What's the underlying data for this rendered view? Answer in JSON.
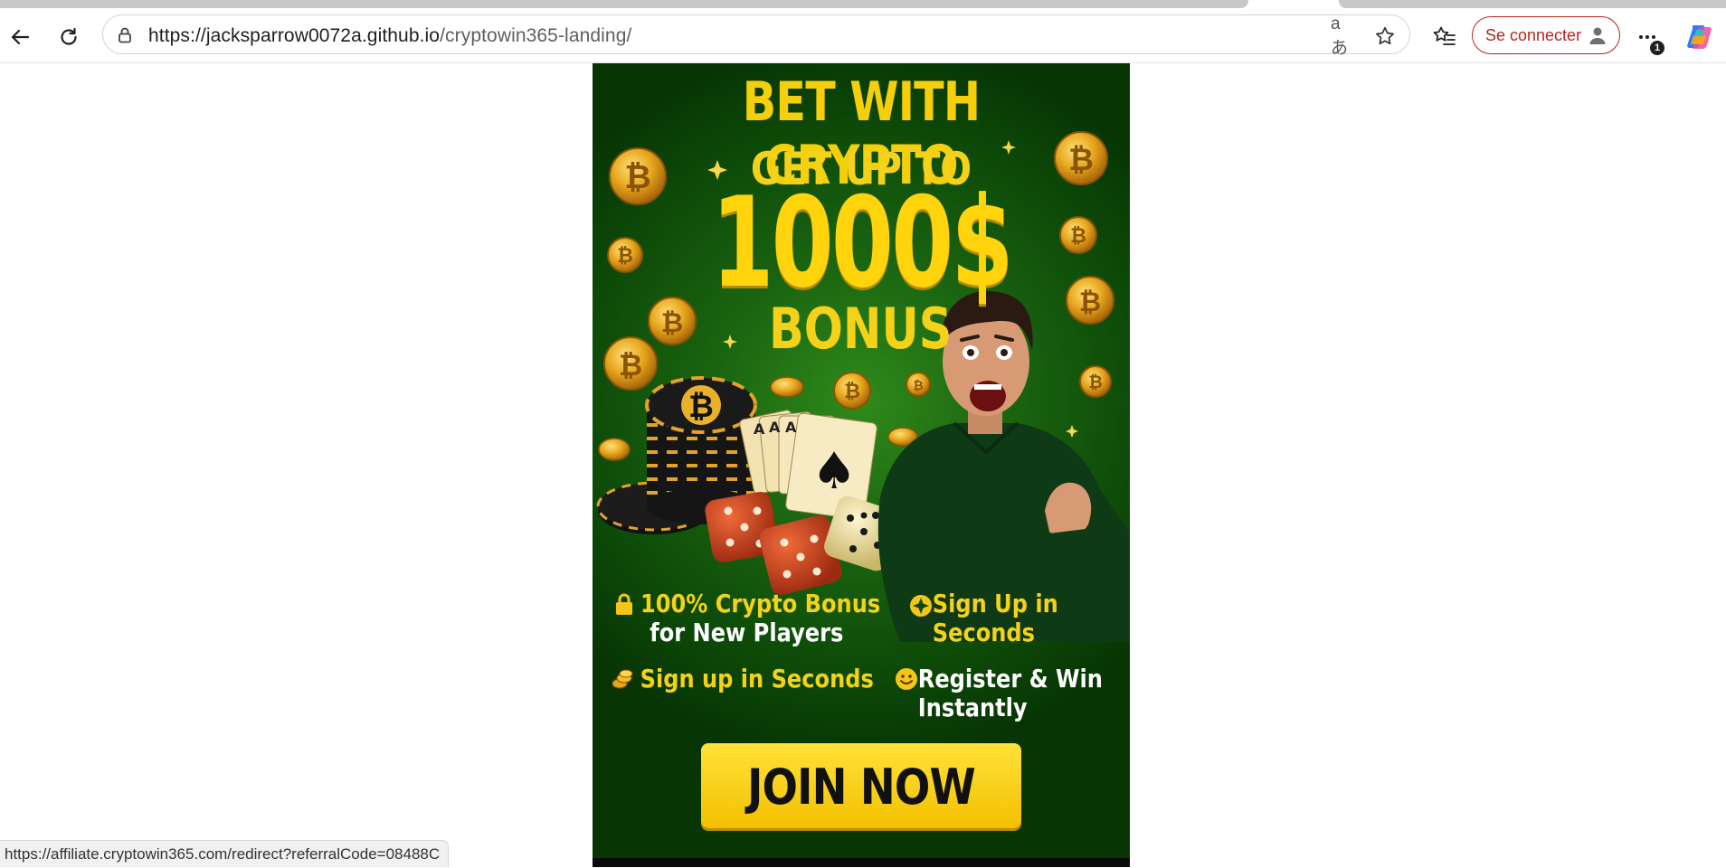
{
  "browser": {
    "url_host": "https://jacksparrow0072a.github.io",
    "url_path": "/cryptowin365-landing/",
    "signin_label": "Se connecter",
    "menu_badge": "1",
    "status_url": "https://affiliate.cryptowin365.com/redirect?referralCode=08488C",
    "icons": {
      "back": "back-arrow-icon",
      "reload": "reload-icon",
      "site_info": "lock-icon",
      "translate": "translate-icon",
      "translate_glyph": "aあ",
      "favorite": "star-icon",
      "favorites": "favorites-icon",
      "profile": "profile-icon",
      "menu": "more-icon",
      "copilot": "copilot-icon"
    },
    "colors": {
      "signin_accent": "#b3261e"
    }
  },
  "banner": {
    "headline": "BET WITH CRYPTO",
    "subheadline": "GET UP TO",
    "amount": "1000$",
    "bonus": "BONUS",
    "features": [
      {
        "icon": "lock-icon",
        "line1": "100% Crypto Bonus",
        "line2": "for New Players"
      },
      {
        "icon": "sparkle-icon",
        "line1": "Sign Up in",
        "line2": "Seconds"
      },
      {
        "icon": "coins-icon",
        "line1": "Sign up in Seconds",
        "line2": ""
      },
      {
        "icon": "smiley-icon",
        "line1": "Register & Win",
        "line2": "Instantly"
      }
    ],
    "cta": "JOIN NOW",
    "colors": {
      "background": "#0d4a08",
      "accent": "#f5d21a",
      "cta": "#ffd40c"
    }
  }
}
